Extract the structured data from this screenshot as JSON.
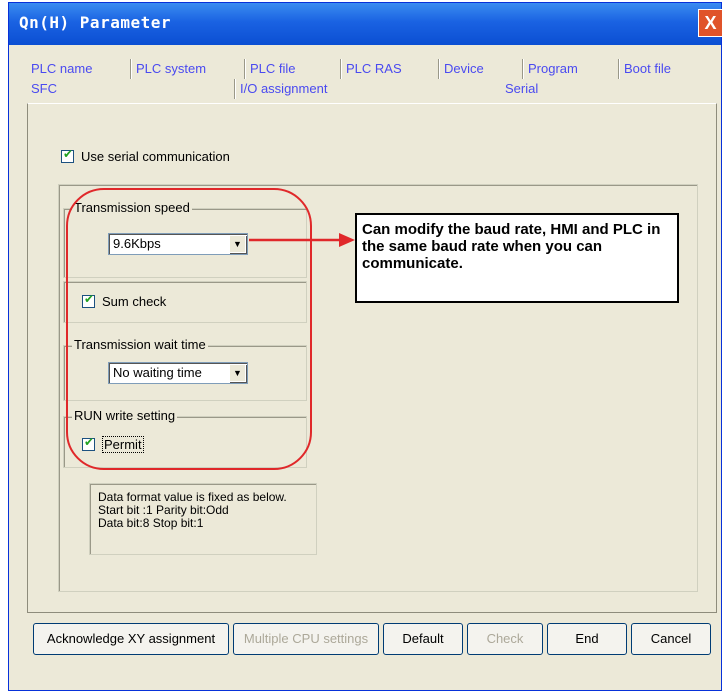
{
  "window": {
    "title": "Qn(H) Parameter",
    "close_label": "X"
  },
  "tabs_row1": [
    "PLC name",
    "PLC system",
    "PLC file",
    "PLC RAS",
    "Device",
    "Program",
    "Boot file"
  ],
  "tabs_row2": [
    "SFC",
    "I/O assignment",
    "Serial"
  ],
  "serial": {
    "use_serial": "Use serial communication",
    "transmission_speed": {
      "label": "Transmission speed",
      "value": "9.6Kbps"
    },
    "sum_check": "Sum check",
    "wait_time": {
      "label": "Transmission wait time",
      "value": "No waiting time"
    },
    "run_write": {
      "label": "RUN write setting",
      "permit": "Permit"
    },
    "fixed_lines": [
      "Data format value is fixed as below.",
      "Start bit :1   Parity bit:Odd",
      "Data bit:8   Stop bit:1"
    ]
  },
  "annotation": "Can modify the baud rate, HMI and PLC in the same baud rate when you can communicate.",
  "buttons": {
    "acknowledge": "Acknowledge XY assignment",
    "multiple_cpu": "Multiple CPU settings",
    "default": "Default",
    "check": "Check",
    "end": "End",
    "cancel": "Cancel"
  },
  "colors": {
    "titlebar": "#0b4fd3",
    "annotation_red": "#e0282a",
    "tab_text": "#4a4af0"
  }
}
